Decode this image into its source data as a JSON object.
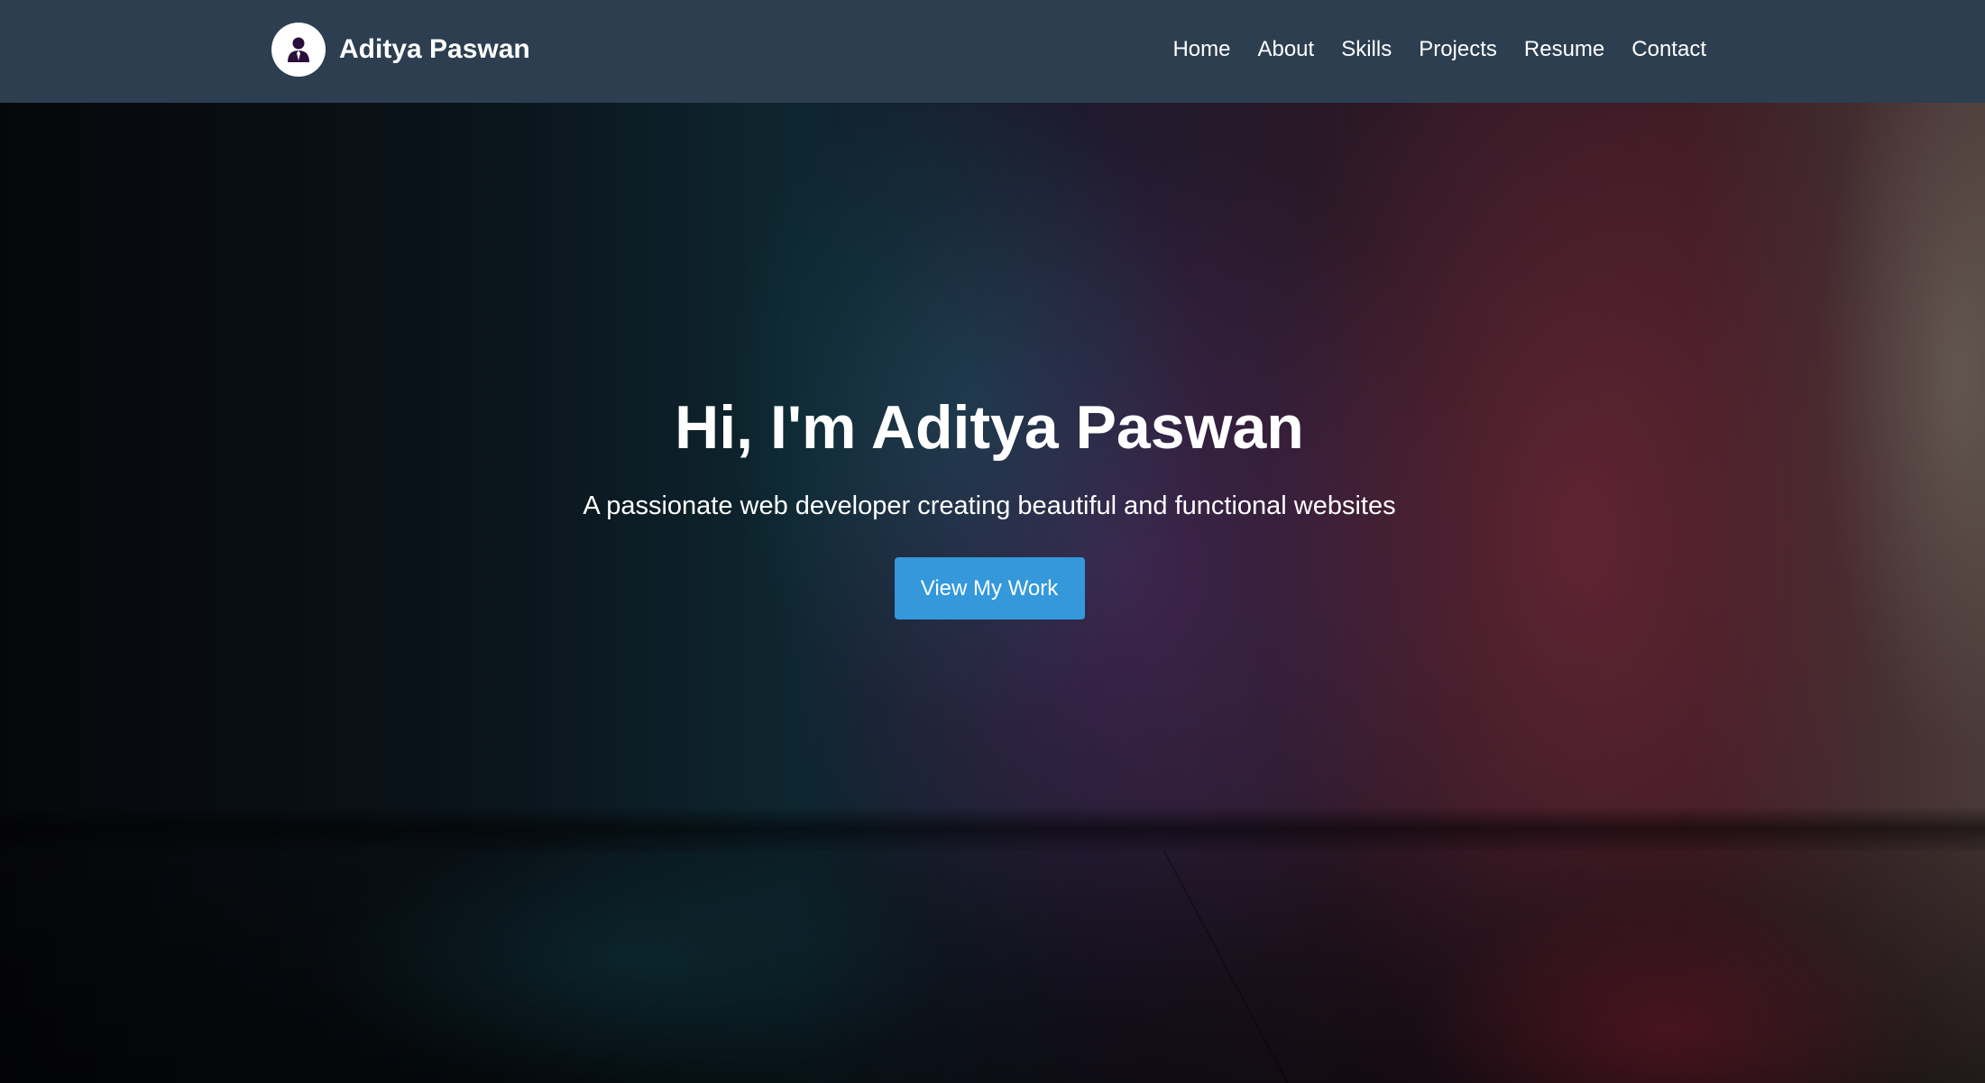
{
  "header": {
    "brand_name": "Aditya Paswan",
    "logo_icon": "user-avatar-icon",
    "background_color": "#2c3e50"
  },
  "nav": {
    "items": [
      {
        "label": "Home"
      },
      {
        "label": "About"
      },
      {
        "label": "Skills"
      },
      {
        "label": "Projects"
      },
      {
        "label": "Resume"
      },
      {
        "label": "Contact"
      }
    ]
  },
  "hero": {
    "title": "Hi, I'm Aditya Paswan",
    "subtitle": "A passionate web developer creating beautiful and functional websites",
    "cta_label": "View My Work",
    "cta_color": "#3498db"
  }
}
